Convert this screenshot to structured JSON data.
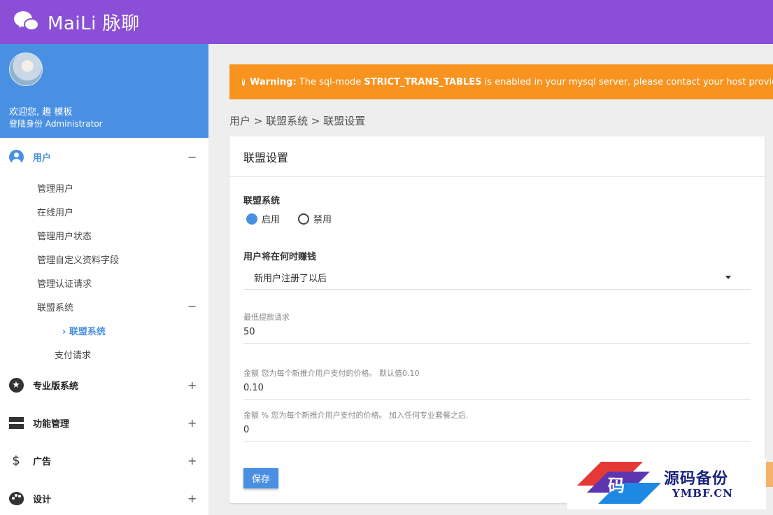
{
  "header": {
    "brand": "MaiLi 脉聊",
    "colors": {
      "bar": "#8a4fd6"
    }
  },
  "profile": {
    "welcome": "欢迎您, 趣 模板",
    "role": "登陆身份 Administrator"
  },
  "sidebar": {
    "users": {
      "label": "用户",
      "toggle": "−",
      "icon": "user-circle-icon"
    },
    "user_items": [
      "管理用户",
      "在线用户",
      "管理用户状态",
      "管理自定义资料字段",
      "管理认证请求"
    ],
    "affiliate": {
      "label": "联盟系统",
      "toggle": "−"
    },
    "affiliate_sub": {
      "chevron": "›",
      "label": "联盟系统"
    },
    "payment_requests": "支付请求",
    "sections": [
      {
        "label": "专业版系统",
        "toggle": "+",
        "icon": "star-icon"
      },
      {
        "label": "功能管理",
        "toggle": "+",
        "icon": "bars-icon"
      },
      {
        "label": "广告",
        "toggle": "+",
        "icon": "dollar-icon"
      },
      {
        "label": "设计",
        "toggle": "+",
        "icon": "palette-icon"
      }
    ],
    "dollar_glyph": "$"
  },
  "warning": {
    "prefix": "Warning:",
    "text1": " The sql-mode ",
    "mode": "STRICT_TRANS_TABLES",
    "text2": " is enabled in your mysql server, please contact your host provider to di"
  },
  "breadcrumb": "用户 > 联盟系统 > 联盟设置",
  "card": {
    "title": "联盟设置",
    "system_label": "联盟系统",
    "radio_on": "启用",
    "radio_off": "禁用",
    "earn_label": "用户将在何时赚钱",
    "earn_value": "新用户注册了以后",
    "min_withdraw_label": "最低提款请求",
    "min_withdraw_value": "50",
    "amount_label": "金额 您为每个新推介用户支付的价格。 默认值0.10",
    "amount_value": "0.10",
    "percent_label": "金额 % 您为每个新推介用户支付的价格。 加入任何专业套餐之后.",
    "percent_value": "0",
    "save": "保存"
  },
  "watermark": {
    "glyph": "码",
    "title": "源码备份",
    "domain": "YMBF.CN"
  }
}
